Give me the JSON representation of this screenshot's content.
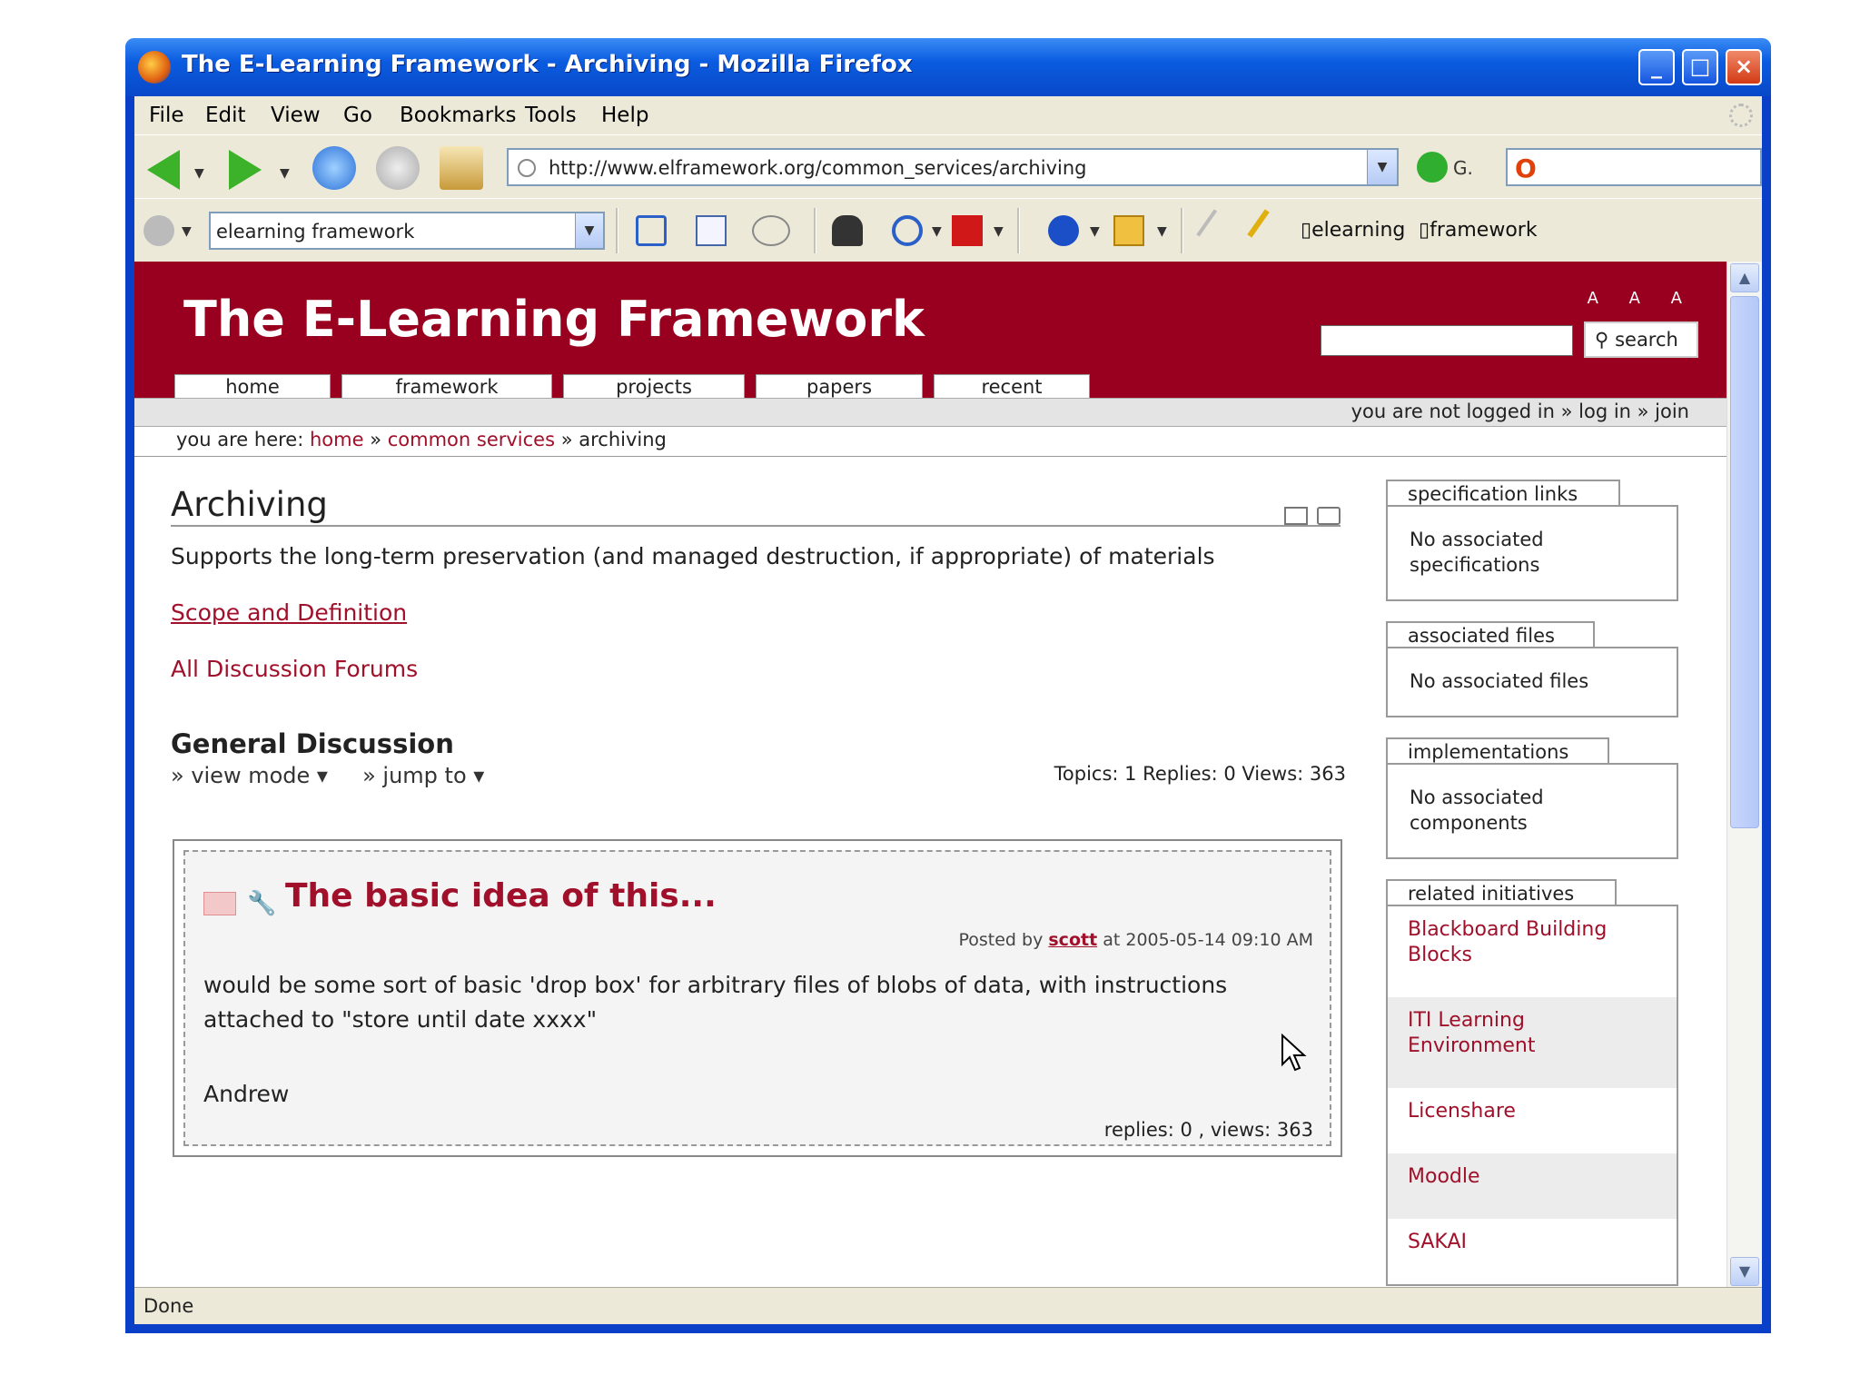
{
  "window": {
    "title": "The E-Learning Framework - Archiving - Mozilla Firefox"
  },
  "menu": [
    "File",
    "Edit",
    "View",
    "Go",
    "Bookmarks",
    "Tools",
    "Help"
  ],
  "nav": {
    "url": "http://www.elframework.org/common_services/archiving",
    "go_label": "G."
  },
  "toolbar": {
    "search_value": "elearning framework",
    "bookmark1": "elearning",
    "bookmark2": "framework"
  },
  "site": {
    "title": "The E-Learning Framework",
    "text_size": "A A A",
    "search_button": "search",
    "tabs": [
      "home",
      "framework",
      "projects",
      "papers",
      "recent"
    ],
    "login": "you are not logged in  » log in  » join",
    "breadcrumb_label": "you are here:",
    "breadcrumb": [
      "home",
      "common services",
      "archiving"
    ]
  },
  "page": {
    "heading": "Archiving",
    "description": "Supports the long-term preservation (and managed destruction, if appropriate) of materials",
    "scope_link": "Scope and Definition",
    "forums_link": "All Discussion Forums",
    "discussion_heading": "General Discussion",
    "view_mode": "» view mode ▾",
    "jump_to": "» jump to ▾",
    "stats": "Topics: 1   Replies: 0   Views: 363"
  },
  "post": {
    "title": "The basic idea of this...",
    "posted_by_label": "Posted by",
    "author": "scott",
    "timestamp": "at 2005-05-14 09:10 AM",
    "body": "would be some sort of basic 'drop box' for arbitrary files of blobs of data, with instructions attached to \"store until date xxxx\"",
    "signature": "Andrew",
    "footer": "replies: 0 , views: 363"
  },
  "sidebar": {
    "spec_tab": "specification links",
    "spec_text": "No associated specifications",
    "files_tab": "associated files",
    "files_text": "No associated files",
    "impl_tab": "implementations",
    "impl_text": "No associated components",
    "related_tab": "related initiatives",
    "related": [
      "Blackboard Building Blocks",
      "ITI Learning Environment",
      "Licenshare",
      "Moodle",
      "SAKAI"
    ]
  },
  "status": {
    "text": "Done"
  }
}
